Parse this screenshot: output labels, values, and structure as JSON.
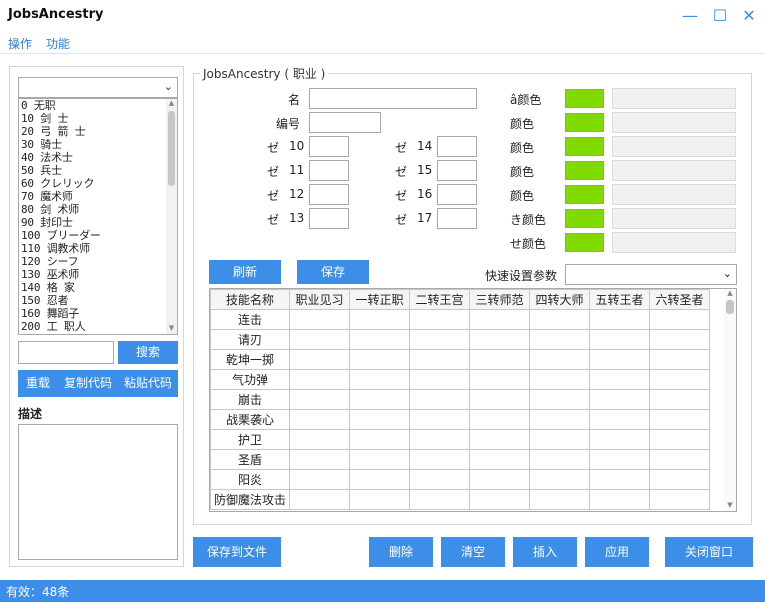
{
  "window": {
    "title": "JobsAncestry",
    "minimize_glyph": "—",
    "maximize_glyph": "☐",
    "close_glyph": "✕"
  },
  "menu": {
    "items": [
      "操作",
      "功能"
    ]
  },
  "left": {
    "combo_value": "",
    "jobs": [
      "0   无职",
      "10  剑  士",
      "20  弓  箭  士",
      "30  骑士",
      "40  法术士",
      "50  兵士",
      "60  クレリック",
      "70  魔术师",
      "80  剑  术师",
      "90  封印士",
      "100 ブリーダー",
      "110 调教术师",
      "120 シーフ",
      "130 巫术师",
      "140 格  家",
      "150 忍者",
      "160 舞蹈子",
      "200 工  职人"
    ],
    "search_value": "",
    "search_label": "搜索",
    "reload_label": "重载",
    "copy_label": "复制代码",
    "paste_label": "粘贴代码",
    "desc_label": "描述",
    "desc_value": ""
  },
  "form": {
    "group_title": "JobsAncestry ( 职业 )",
    "name_label": "名",
    "id_label": "编号",
    "lv_prefix": "ゼ",
    "lv_left": [
      "10",
      "11",
      "12",
      "13"
    ],
    "lv_right": [
      "14",
      "15",
      "16",
      "17"
    ],
    "color_labels": [
      "â颜色",
      "颜色",
      "颜色",
      "颜色",
      "颜色",
      "き颜色",
      "せ颜色"
    ],
    "swatch_color": "#7fdb00",
    "refresh_label": "刷新",
    "save_label": "保存",
    "quickset_label": "快速设置参数",
    "quickset_value": ""
  },
  "grid": {
    "headers": [
      "技能名称",
      "职业见习",
      "一转正职",
      "二转王宫",
      "三转师范",
      "四转大师",
      "五转王者",
      "六转圣者"
    ],
    "rows": [
      "连击",
      "请刃",
      "乾坤一掷",
      "气功弹",
      "崩击",
      "战栗袭心",
      "护卫",
      "圣盾",
      "阳炎",
      "防御魔法攻击"
    ]
  },
  "bottom": {
    "save_file_label": "保存到文件",
    "delete_label": "删除",
    "clear_label": "清空",
    "insert_label": "插入",
    "apply_label": "应用",
    "close_label": "关闭窗口"
  },
  "status": {
    "text": "有效：48条"
  }
}
